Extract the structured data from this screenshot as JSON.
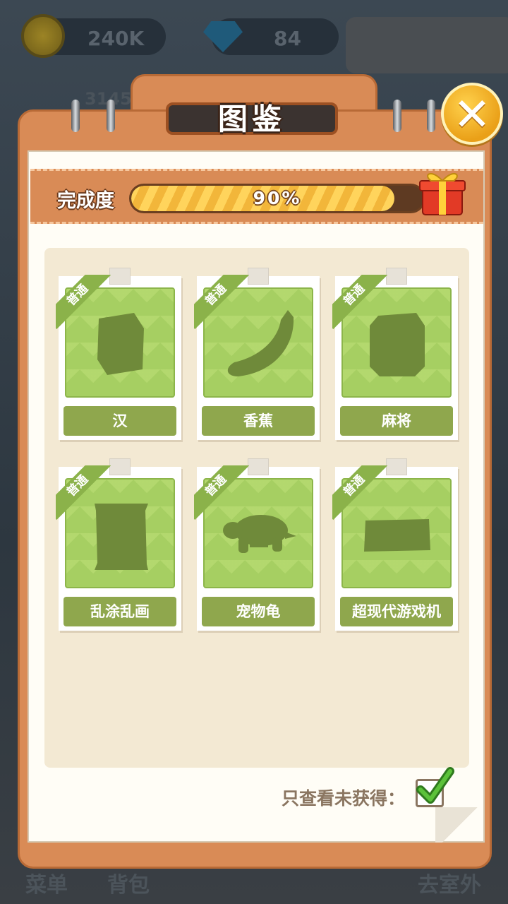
{
  "hud": {
    "coins": "240K",
    "gems": "84",
    "level": "3145",
    "menu_label": "菜单",
    "bag_label": "背包",
    "outdoor_label": "去室外"
  },
  "dialog": {
    "title": "图鉴",
    "close_icon": "close-icon",
    "progress_label": "完成度",
    "progress_text": "90%",
    "progress_value": 0.9,
    "gift_icon": "gift-box-icon"
  },
  "collection": {
    "items": [
      {
        "rarity": "普通",
        "name": "汉",
        "icon": "silhouette-burger-icon"
      },
      {
        "rarity": "普通",
        "name": "香蕉",
        "icon": "silhouette-banana-icon"
      },
      {
        "rarity": "普通",
        "name": "麻将",
        "icon": "silhouette-mahjong-icon"
      },
      {
        "rarity": "普通",
        "name": "乱涂乱画",
        "icon": "silhouette-scroll-icon"
      },
      {
        "rarity": "普通",
        "name": "宠物龟",
        "icon": "silhouette-turtle-icon"
      },
      {
        "rarity": "普通",
        "name": "超现代游戏机",
        "icon": "silhouette-console-icon"
      }
    ]
  },
  "filter": {
    "label": "只查看未获得：",
    "checked": true
  },
  "colors": {
    "frame": "#d98b56",
    "silhouette": "#6f8a3a",
    "card_green": "#a6cf62",
    "label_green": "#8fa74d"
  }
}
